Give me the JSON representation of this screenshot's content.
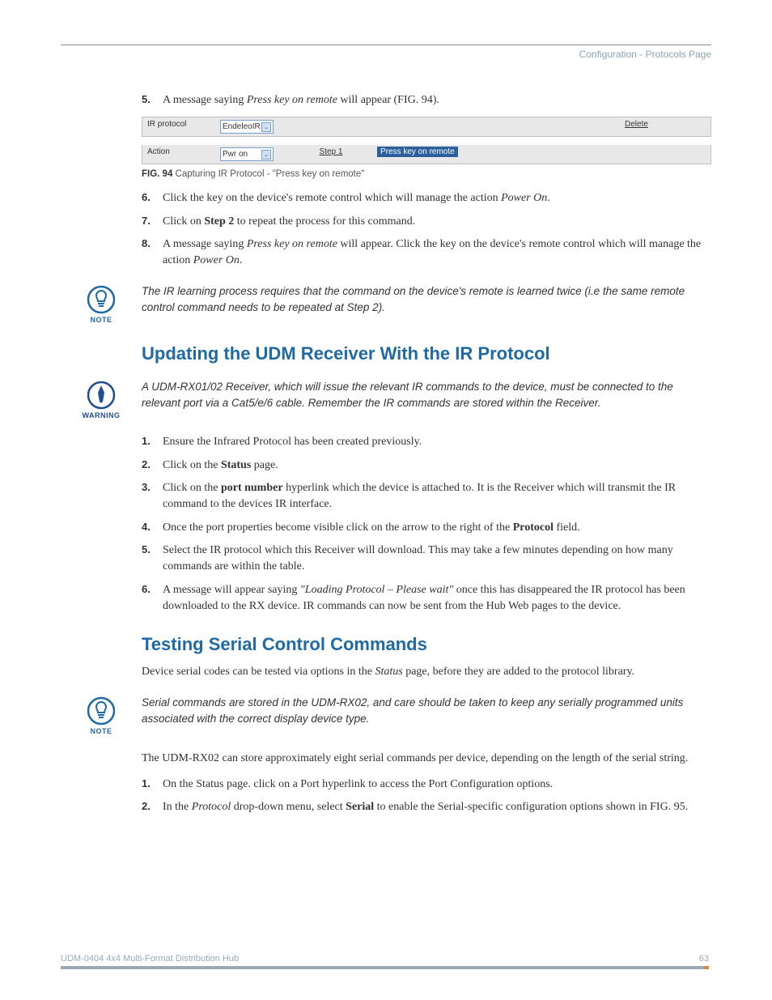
{
  "breadcrumb": "Configuration - Protocols Page",
  "intro_list": [
    {
      "n": "5.",
      "html": "A message saying <em data-bind='intro_list.0.italic'></em> will appear (FIG. 94).",
      "italic": "Press key on remote"
    }
  ],
  "fig94": {
    "row1_label": "IR protocol",
    "row1_select": "EndeleoIR",
    "row1_delete": "Delete",
    "row2_label": "Action",
    "row2_select": "Pwr on",
    "row2_step": "Step 1",
    "row2_msg": "Press key on remote",
    "caption_bold": "FIG. 94",
    "caption_rest": " Capturing IR Protocol - \"Press key on remote\""
  },
  "after_fig_list": [
    {
      "n": "6.",
      "text": "Click the key on the device's remote control which will manage the action ",
      "italic": "Power On",
      "suffix": "."
    },
    {
      "n": "7.",
      "prefix": "Click on ",
      "bold": "Step 2",
      "suffix": " to repeat the process for this command."
    },
    {
      "n": "8.",
      "prefix": "A message saying ",
      "italic": "Press key on remote",
      "middle": " will appear. Click the key on the device's remote control which will manage the action ",
      "italic2": "Power On",
      "suffix": "."
    }
  ],
  "note1": "The IR learning process requires that the command on the device's remote is learned twice (i.e the same remote control command needs to be repeated at Step 2).",
  "note_label": "NOTE",
  "section1_title": "Updating the UDM Receiver With the IR Protocol",
  "warning_text": "A UDM-RX01/02 Receiver, which will issue the relevant IR commands to the device, must be connected to the relevant port via a Cat5/e/6 cable. Remember the IR commands are stored within the Receiver.",
  "warning_label": "WARNING",
  "sec1_list": [
    {
      "n": "1.",
      "text": "Ensure the Infrared Protocol has been created previously."
    },
    {
      "n": "2.",
      "prefix": "Click on the ",
      "bold": "Status",
      "suffix": " page."
    },
    {
      "n": "3.",
      "prefix": "Click on the ",
      "bold": "port number",
      "suffix": " hyperlink which the device is attached to. It is the Receiver which will transmit the IR command to the devices IR interface."
    },
    {
      "n": "4.",
      "prefix": "Once the port properties become visible click on the arrow to the right of the ",
      "bold": "Protocol",
      "suffix": " field."
    },
    {
      "n": "5.",
      "text": "Select the IR protocol which this Receiver will download. This may take a few minutes depending on how many commands are within the table."
    },
    {
      "n": "6.",
      "prefix": "A message will appear saying ",
      "italic": "\"Loading Protocol – Please wait\"",
      "suffix": " once this has disappeared the IR protocol has been downloaded to the RX device. IR commands can now be sent from the Hub Web pages to the device."
    }
  ],
  "section2_title": "Testing Serial Control Commands",
  "sec2_intro_prefix": "Device serial codes can be tested via options in the ",
  "sec2_intro_italic": "Status",
  "sec2_intro_suffix": " page, before they are added to the protocol library.",
  "note2": "Serial commands are stored in the UDM-RX02, and care should be taken to keep any serially programmed units associated with the correct display device type.",
  "sec2_para": "The UDM-RX02 can store approximately eight serial commands per device, depending on the length of the serial string.",
  "sec2_list": [
    {
      "n": "1.",
      "text": "On the Status page. click on a Port hyperlink to access the Port Configuration options."
    },
    {
      "n": "2.",
      "prefix": "In the ",
      "italic": "Protocol",
      "middle": " drop-down menu, select ",
      "bold": "Serial",
      "suffix": " to enable the Serial-specific configuration options shown in FIG. 95."
    }
  ],
  "footer_left": "UDM-0404 4x4 Multi-Format Distribution Hub",
  "footer_right": "63"
}
